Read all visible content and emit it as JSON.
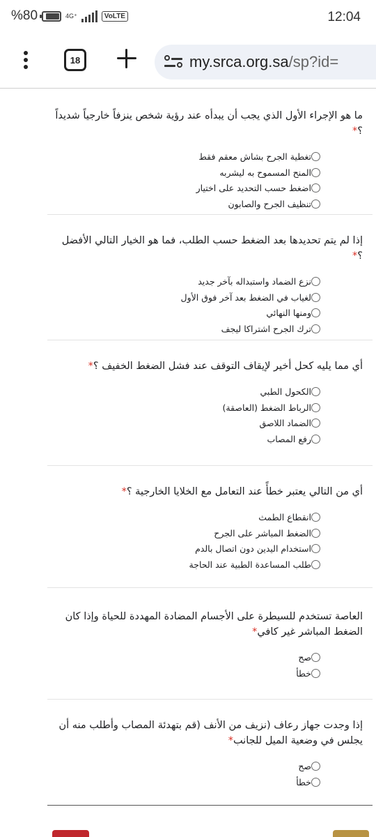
{
  "status_bar": {
    "battery": "%80",
    "network": "4G⁺",
    "volte": "VoLTE",
    "time": "12:04"
  },
  "browser": {
    "tab_count": "18",
    "url_host": "my.srca.org.sa",
    "url_path": "/sp?id="
  },
  "questions": [
    {
      "title": "ما هو الإجراء الأول الذي يجب أن يبدأه عند رؤية شخص ينزفاً خارجياً شديداً ؟",
      "required_mark": "*",
      "options": [
        "تغطية الجرح بشاش معقم فقط",
        "المنح المسموح به ليشربه",
        "اضغط حسب التحديد على اختيار",
        "تنظيف الجرح والصابون"
      ]
    },
    {
      "title": "إذا لم يتم تحديدها بعد الضغط حسب الطلب، فما هو الخيار التالي الأفضل ؟",
      "required_mark": "*",
      "options": [
        "نزع الضماد واستبداله بآخر جديد",
        "لغياب في الضغط بعد آخر فوق الأول",
        "ومنها النهائي",
        "ترك الجرح اشتراكا ليجف"
      ]
    },
    {
      "title": "أي مما يليه كحل أخير لإيقاف التوقف عند فشل الضغط الخفيف ؟",
      "required_mark": "*",
      "options": [
        "الكحول الطبي",
        "الرباط الضغط (العاصقة)",
        "الضماد اللاصق",
        "رفع المصاب"
      ]
    },
    {
      "title": "أي من التالي يعتبر خطأً عند التعامل مع الخلايا الخارجية ؟",
      "required_mark": "*",
      "options": [
        "انقطاع الطمث",
        "الضغط المباشر على الجرح",
        "استخدام اليدين دون اتصال بالدم",
        "طلب المساعدة الطبية عند الحاجة"
      ]
    },
    {
      "title": "العاصة تستخدم للسيطرة على الأجسام المضادة المهددة للحياة وإذا كان الضغط المباشر غير كافي",
      "required_mark": "*",
      "options": [
        "صح",
        "خطأ"
      ]
    },
    {
      "title": "إذا وجدت جهاز رعاف (نزيف من الأنف (قم بتهدئة المصاب وأطلب منه أن يجلس في وضعية الميل للجانب",
      "required_mark": "*",
      "options": [
        "صح",
        "خطأ"
      ]
    }
  ]
}
